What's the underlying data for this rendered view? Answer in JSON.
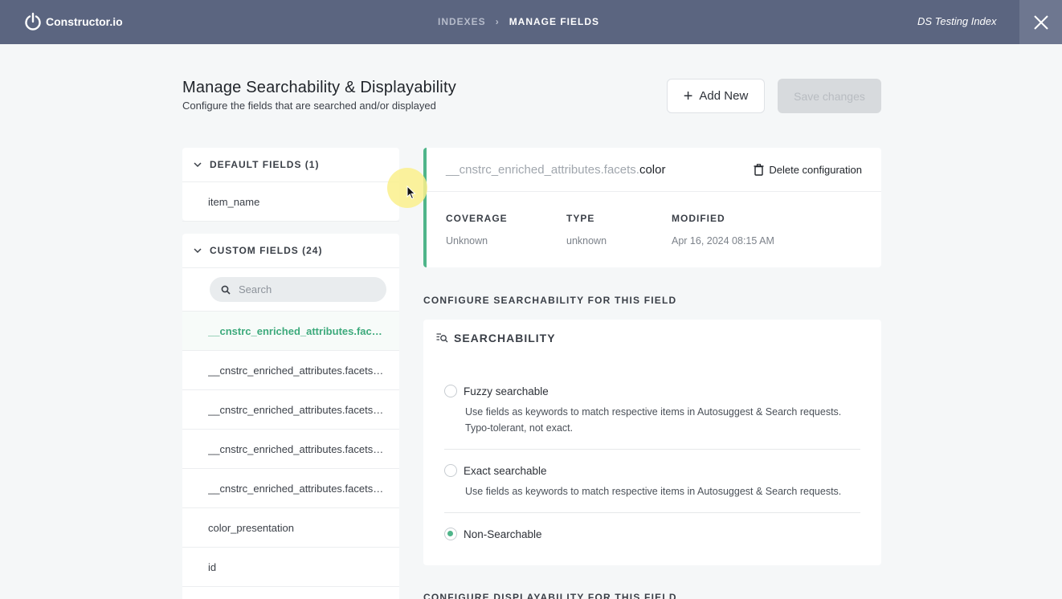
{
  "topbar": {
    "brand": "Constructor.io",
    "breadcrumb": [
      "INDEXES",
      "MANAGE FIELDS"
    ],
    "breadcrumb_separator": "›",
    "index_name": "DS Testing Index",
    "colors": {
      "bar": "#5b6580",
      "close": "#6e7790"
    }
  },
  "header": {
    "title": "Manage Searchability & Displayability",
    "subtitle": "Configure the fields that are searched and/or displayed",
    "add_new_label": "Add New",
    "save_label": "Save changes"
  },
  "default_fields": {
    "title": "DEFAULT FIELDS (1)",
    "items": [
      "item_name"
    ]
  },
  "custom_fields": {
    "title": "CUSTOM FIELDS (24)",
    "search_placeholder": "Search",
    "items": [
      "__cnstrc_enriched_attributes.facets.color",
      "__cnstrc_enriched_attributes.facets.material",
      "__cnstrc_enriched_attributes.facets.pattern",
      "__cnstrc_enriched_attributes.facets.style",
      "__cnstrc_enriched_attributes.facets.type",
      "color_presentation",
      "id"
    ],
    "active_index": 0
  },
  "detail": {
    "field_prefix": "__cnstrc_enriched_attributes.facets.",
    "field_suffix": "color",
    "delete_label": "Delete configuration",
    "coverage_label": "COVERAGE",
    "coverage_value": "Unknown",
    "type_label": "TYPE",
    "type_value": "unknown",
    "modified_label": "MODIFIED",
    "modified_value": "Apr 16, 2024 08:15 AM",
    "accent": "#4fb58a"
  },
  "searchability": {
    "section_title": "CONFIGURE SEARCHABILITY FOR THIS FIELD",
    "card_title": "SEARCHABILITY",
    "options": [
      {
        "label": "Fuzzy searchable",
        "desc1": "Use fields as keywords to match respective items in Autosuggest & Search requests.",
        "desc2": "Typo-tolerant, not exact.",
        "checked": false
      },
      {
        "label": "Exact searchable",
        "desc1": "Use fields as keywords to match respective items in Autosuggest & Search requests.",
        "checked": false
      },
      {
        "label": "Non-Searchable",
        "checked": true
      }
    ]
  },
  "displayability": {
    "section_title": "CONFIGURE DISPLAYABILITY FOR THIS FIELD"
  }
}
